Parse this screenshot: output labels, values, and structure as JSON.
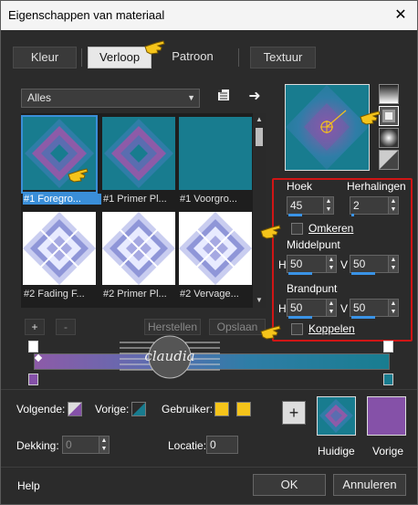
{
  "window": {
    "title": "Eigenschappen van materiaal",
    "close_glyph": "✕"
  },
  "tabs": [
    {
      "label": "Kleur",
      "active": false
    },
    {
      "label": "Verloop",
      "active": true
    },
    {
      "label": "Patroon",
      "active": false
    },
    {
      "label": "Textuur",
      "active": false
    }
  ],
  "gallery": {
    "filter_value": "Alles",
    "items": [
      {
        "caption": "#1 Foregro...",
        "selected": true,
        "style": "diamond-dark"
      },
      {
        "caption": "#1 Primer Pl...",
        "selected": false,
        "style": "diamond-dark"
      },
      {
        "caption": "#1 Voorgro...",
        "selected": false,
        "style": "solid-teal"
      },
      {
        "caption": "#2 Fading F...",
        "selected": false,
        "style": "diamond-light"
      },
      {
        "caption": "#2 Primer Pl...",
        "selected": false,
        "style": "diamond-light"
      },
      {
        "caption": "#2 Vervage...",
        "selected": false,
        "style": "diamond-light"
      }
    ],
    "add_label": "+",
    "remove_label": "-",
    "reset_label": "Herstellen",
    "save_label": "Opslaan"
  },
  "settings": {
    "angle_label": "Hoek",
    "angle_value": "45",
    "angle_fraction": 0.125,
    "repeats_label": "Herhalingen",
    "repeats_value": "2",
    "repeats_fraction": 0.02,
    "invert_label": "Omkeren",
    "invert_checked": false,
    "midpoint_label": "Middelpunt",
    "mid_h_label": "H",
    "mid_h_value": "50",
    "mid_v_label": "V",
    "mid_v_value": "50",
    "focal_label": "Brandpunt",
    "focal_h_label": "H",
    "focal_h_value": "50",
    "focal_v_label": "V",
    "focal_v_value": "50",
    "link_label": "Koppelen",
    "link_checked": false,
    "mid_fraction": 0.5
  },
  "stops": {
    "next_label": "Volgende:",
    "prev_label": "Vorige:",
    "user_label": "Gebruiker:",
    "opacity_label": "Dekking:",
    "opacity_value": "0",
    "location_label": "Locatie:",
    "location_value": "0"
  },
  "colors": {
    "purple": "#8551a8",
    "teal": "#187c8f",
    "yellow": "#f5c41a",
    "accent_blue": "#3a8ed8",
    "red_frame": "#d01515"
  },
  "preview": {
    "current_label": "Huidige",
    "previous_label": "Vorige"
  },
  "footer": {
    "help_label": "Help",
    "ok_label": "OK",
    "cancel_label": "Annuleren"
  },
  "watermark_text": "claudia"
}
